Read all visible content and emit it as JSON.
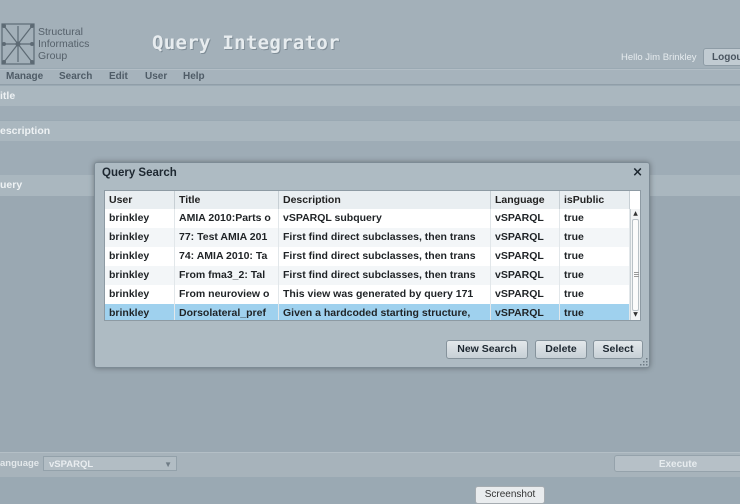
{
  "header": {
    "logo_text": "Structural\nInformatics\nGroup",
    "app_title": "Query Integrator",
    "greeting": "Hello Jim Brinkley",
    "logout_label": "Logou"
  },
  "menu": {
    "items": [
      {
        "label": "Manage"
      },
      {
        "label": "Search"
      },
      {
        "label": "Edit"
      },
      {
        "label": "User"
      },
      {
        "label": "Help"
      }
    ]
  },
  "form": {
    "title_label": "itle",
    "description_label": "escription",
    "query_label": "uery",
    "language_label": "anguage",
    "language_value": "vSPARQL",
    "execute_label": "Execute"
  },
  "dialog": {
    "title": "Query Search",
    "close_glyph": "×",
    "columns": [
      "User",
      "Title",
      "Description",
      "Language",
      "isPublic"
    ],
    "rows": [
      {
        "user": "brinkley",
        "title": "AMIA 2010:Parts o",
        "description": "vSPARQL subquery",
        "language": "vSPARQL",
        "is_public": "true",
        "selected": false
      },
      {
        "user": "brinkley",
        "title": "77: Test AMIA 201",
        "description": "First find direct subclasses, then trans",
        "language": "vSPARQL",
        "is_public": "true",
        "selected": false
      },
      {
        "user": "brinkley",
        "title": "74: AMIA 2010: Ta",
        "description": "First find direct subclasses, then trans",
        "language": "vSPARQL",
        "is_public": "true",
        "selected": false
      },
      {
        "user": "brinkley",
        "title": "From fma3_2: Tal",
        "description": "First find direct subclasses, then trans",
        "language": "vSPARQL",
        "is_public": "true",
        "selected": false
      },
      {
        "user": "brinkley",
        "title": "From neuroview o",
        "description": "This view was generated by query 171",
        "language": "vSPARQL",
        "is_public": "true",
        "selected": false
      },
      {
        "user": "brinkley",
        "title": "Dorsolateral_pref",
        "description": "Given a hardcoded starting structure,",
        "language": "vSPARQL",
        "is_public": "true",
        "selected": true
      }
    ],
    "buttons": {
      "new_search": "New Search",
      "delete": "Delete",
      "select": "Select"
    }
  },
  "footer": {
    "screenshot_label": "Screenshot"
  },
  "colors": {
    "overlay_bg": "#9aa9b3",
    "selected_row": "#9fd1ee",
    "dialog_bg": "#aebbc3"
  }
}
